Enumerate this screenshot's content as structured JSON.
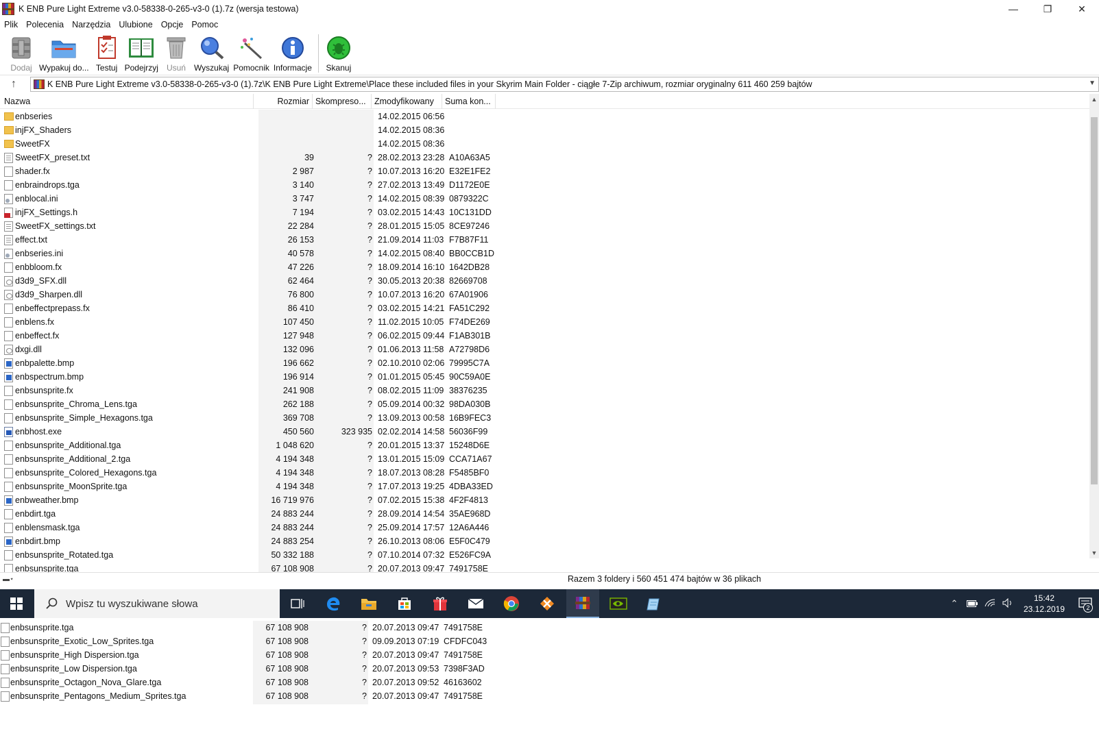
{
  "window": {
    "title": "K ENB Pure Light Extreme v3.0-58338-0-265-v3-0 (1).7z (wersja testowa)",
    "minimize": "—",
    "maximize": "❐",
    "close": "✕"
  },
  "menu": [
    "Plik",
    "Polecenia",
    "Narzędzia",
    "Ulubione",
    "Opcje",
    "Pomoc"
  ],
  "toolbar": [
    {
      "label": "Dodaj",
      "icon": "add-archive-icon",
      "disabled": true
    },
    {
      "label": "Wypakuj do...",
      "icon": "extract-folder-icon",
      "disabled": false
    },
    {
      "label": "Testuj",
      "icon": "test-checklist-icon",
      "disabled": false
    },
    {
      "label": "Podejrzyj",
      "icon": "view-book-icon",
      "disabled": false
    },
    {
      "label": "Usuń",
      "icon": "trash-icon",
      "disabled": true
    },
    {
      "label": "Wyszukaj",
      "icon": "magnifier-icon",
      "disabled": false
    },
    {
      "label": "Pomocnik",
      "icon": "wizard-wand-icon",
      "disabled": false
    },
    {
      "label": "Informacje",
      "icon": "info-icon",
      "disabled": false
    },
    {
      "label": "Skanuj",
      "icon": "virus-scan-icon",
      "disabled": false
    }
  ],
  "address": {
    "up": "↑",
    "path": "K ENB Pure Light Extreme v3.0-58338-0-265-v3-0 (1).7z\\K ENB Pure Light Extreme\\Place these included files in your Skyrim Main Folder - ciągłe 7-Zip archiwum, rozmiar oryginalny 611 460 259 bajtów"
  },
  "columns": {
    "name": "Nazwa",
    "size": "Rozmiar",
    "packed": "Skompreso...",
    "modified": "Zmodyfikowany",
    "crc": "Suma kon..."
  },
  "files": [
    {
      "name": "enbseries",
      "type": "folder",
      "size": "",
      "packed": "",
      "modified": "14.02.2015 06:56",
      "crc": ""
    },
    {
      "name": "injFX_Shaders",
      "type": "folder",
      "size": "",
      "packed": "",
      "modified": "14.02.2015 08:36",
      "crc": ""
    },
    {
      "name": "SweetFX",
      "type": "folder",
      "size": "",
      "packed": "",
      "modified": "14.02.2015 08:36",
      "crc": ""
    },
    {
      "name": "SweetFX_preset.txt",
      "type": "txt",
      "size": "39",
      "packed": "?",
      "modified": "28.02.2013 23:28",
      "crc": "A10A63A5"
    },
    {
      "name": "shader.fx",
      "type": "blank",
      "size": "2 987",
      "packed": "?",
      "modified": "10.07.2013 16:20",
      "crc": "E32E1FE2"
    },
    {
      "name": "enbraindrops.tga",
      "type": "blank",
      "size": "3 140",
      "packed": "?",
      "modified": "27.02.2013 13:49",
      "crc": "D1172E0E"
    },
    {
      "name": "enblocal.ini",
      "type": "ini",
      "size": "3 747",
      "packed": "?",
      "modified": "14.02.2015 08:39",
      "crc": "0879322C"
    },
    {
      "name": "injFX_Settings.h",
      "type": "h",
      "size": "7 194",
      "packed": "?",
      "modified": "03.02.2015 14:43",
      "crc": "10C131DD"
    },
    {
      "name": "SweetFX_settings.txt",
      "type": "txt",
      "size": "22 284",
      "packed": "?",
      "modified": "28.01.2015 15:05",
      "crc": "8CE97246"
    },
    {
      "name": "effect.txt",
      "type": "txt",
      "size": "26 153",
      "packed": "?",
      "modified": "21.09.2014 11:03",
      "crc": "F7B87F11"
    },
    {
      "name": "enbseries.ini",
      "type": "ini",
      "size": "40 578",
      "packed": "?",
      "modified": "14.02.2015 08:40",
      "crc": "BB0CCB1D"
    },
    {
      "name": "enbbloom.fx",
      "type": "blank",
      "size": "47 226",
      "packed": "?",
      "modified": "18.09.2014 16:10",
      "crc": "1642DB28"
    },
    {
      "name": "d3d9_SFX.dll",
      "type": "dll",
      "size": "62 464",
      "packed": "?",
      "modified": "30.05.2013 20:38",
      "crc": "82669708"
    },
    {
      "name": "d3d9_Sharpen.dll",
      "type": "dll",
      "size": "76 800",
      "packed": "?",
      "modified": "10.07.2013 16:20",
      "crc": "67A01906"
    },
    {
      "name": "enbeffectprepass.fx",
      "type": "blank",
      "size": "86 410",
      "packed": "?",
      "modified": "03.02.2015 14:21",
      "crc": "FA51C292"
    },
    {
      "name": "enblens.fx",
      "type": "blank",
      "size": "107 450",
      "packed": "?",
      "modified": "11.02.2015 10:05",
      "crc": "F74DE269"
    },
    {
      "name": "enbeffect.fx",
      "type": "blank",
      "size": "127 948",
      "packed": "?",
      "modified": "06.02.2015 09:44",
      "crc": "F1AB301B"
    },
    {
      "name": "dxgi.dll",
      "type": "dll",
      "size": "132 096",
      "packed": "?",
      "modified": "01.06.2013 11:58",
      "crc": "A72798D6"
    },
    {
      "name": "enbpalette.bmp",
      "type": "bmp",
      "size": "196 662",
      "packed": "?",
      "modified": "02.10.2010 02:06",
      "crc": "79995C7A"
    },
    {
      "name": "enbspectrum.bmp",
      "type": "bmp",
      "size": "196 914",
      "packed": "?",
      "modified": "01.01.2015 05:45",
      "crc": "90C59A0E"
    },
    {
      "name": "enbsunsprite.fx",
      "type": "blank",
      "size": "241 908",
      "packed": "?",
      "modified": "08.02.2015 11:09",
      "crc": "38376235"
    },
    {
      "name": "enbsunsprite_Chroma_Lens.tga",
      "type": "blank",
      "size": "262 188",
      "packed": "?",
      "modified": "05.09.2014 00:32",
      "crc": "98DA030B"
    },
    {
      "name": "enbsunsprite_Simple_Hexagons.tga",
      "type": "blank",
      "size": "369 708",
      "packed": "?",
      "modified": "13.09.2013 00:58",
      "crc": "16B9FEC3"
    },
    {
      "name": "enbhost.exe",
      "type": "exe",
      "size": "450 560",
      "packed": "323 935",
      "modified": "02.02.2014 14:58",
      "crc": "56036F99"
    },
    {
      "name": "enbsunsprite_Additional.tga",
      "type": "blank",
      "size": "1 048 620",
      "packed": "?",
      "modified": "20.01.2015 13:37",
      "crc": "15248D6E"
    },
    {
      "name": "enbsunsprite_Additional_2.tga",
      "type": "blank",
      "size": "4 194 348",
      "packed": "?",
      "modified": "13.01.2015 15:09",
      "crc": "CCA71A67"
    },
    {
      "name": "enbsunsprite_Colored_Hexagons.tga",
      "type": "blank",
      "size": "4 194 348",
      "packed": "?",
      "modified": "18.07.2013 08:28",
      "crc": "F5485BF0"
    },
    {
      "name": "enbsunsprite_MoonSprite.tga",
      "type": "blank",
      "size": "4 194 348",
      "packed": "?",
      "modified": "17.07.2013 19:25",
      "crc": "4DBA33ED"
    },
    {
      "name": "enbweather.bmp",
      "type": "bmp",
      "size": "16 719 976",
      "packed": "?",
      "modified": "07.02.2015 15:38",
      "crc": "4F2F4813"
    },
    {
      "name": "enbdirt.tga",
      "type": "blank",
      "size": "24 883 244",
      "packed": "?",
      "modified": "28.09.2014 14:54",
      "crc": "35AE968D"
    },
    {
      "name": "enblensmask.tga",
      "type": "blank",
      "size": "24 883 244",
      "packed": "?",
      "modified": "25.09.2014 17:57",
      "crc": "12A6A446"
    },
    {
      "name": "enbdirt.bmp",
      "type": "bmp",
      "size": "24 883 254",
      "packed": "?",
      "modified": "26.10.2013 08:06",
      "crc": "E5F0C479"
    },
    {
      "name": "enbsunsprite_Rotated.tga",
      "type": "blank",
      "size": "50 332 188",
      "packed": "?",
      "modified": "07.10.2014 07:32",
      "crc": "E526FC9A"
    },
    {
      "name": "enbsunsprite.tga",
      "type": "blank",
      "size": "67 108 908",
      "packed": "?",
      "modified": "20.07.2013 09:47",
      "crc": "7491758E"
    }
  ],
  "status": {
    "summary": "Razem 3 foldery i 560 451 474 bajtów w 36 plikach"
  },
  "taskbar": {
    "search_placeholder": "Wpisz tu wyszukiwane słowa",
    "apps": [
      "task-view-icon",
      "edge-icon",
      "file-explorer-icon",
      "store-icon",
      "gift-icon",
      "mail-icon",
      "chrome-icon",
      "orange-app-icon",
      "winrar-icon",
      "nvidia-icon",
      "notepad-icon"
    ],
    "clock_time": "15:42",
    "clock_date": "23.12.2019",
    "notifications": "2"
  },
  "lower_files": [
    {
      "name": "enbsunsprite.tga",
      "size": "67 108 908",
      "packed": "?",
      "modified": "20.07.2013 09:47",
      "crc": "7491758E"
    },
    {
      "name": "enbsunsprite_Exotic_Low_Sprites.tga",
      "size": "67 108 908",
      "packed": "?",
      "modified": "09.09.2013 07:19",
      "crc": "CFDFC043"
    },
    {
      "name": "enbsunsprite_High Dispersion.tga",
      "size": "67 108 908",
      "packed": "?",
      "modified": "20.07.2013 09:47",
      "crc": "7491758E"
    },
    {
      "name": "enbsunsprite_Low Dispersion.tga",
      "size": "67 108 908",
      "packed": "?",
      "modified": "20.07.2013 09:53",
      "crc": "7398F3AD"
    },
    {
      "name": "enbsunsprite_Octagon_Nova_Glare.tga",
      "size": "67 108 908",
      "packed": "?",
      "modified": "20.07.2013 09:52",
      "crc": "46163602"
    },
    {
      "name": "enbsunsprite_Pentagons_Medium_Sprites.tga",
      "size": "67 108 908",
      "packed": "?",
      "modified": "20.07.2013 09:47",
      "crc": "7491758E"
    }
  ]
}
